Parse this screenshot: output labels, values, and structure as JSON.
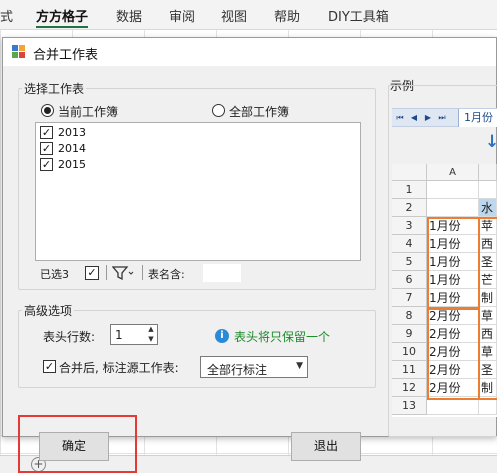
{
  "ribbon": {
    "tabs": [
      {
        "label": "式"
      },
      {
        "label": "方方格子"
      },
      {
        "label": "数据"
      },
      {
        "label": "审阅"
      },
      {
        "label": "视图"
      },
      {
        "label": "帮助"
      },
      {
        "label": "DIY工具箱"
      }
    ]
  },
  "dialog": {
    "title": "合并工作表",
    "select_group": {
      "label": "选择工作表",
      "radio_current": "当前工作簿",
      "radio_all": "全部工作簿",
      "sheets": [
        {
          "name": "2013",
          "checked": true
        },
        {
          "name": "2014",
          "checked": true
        },
        {
          "name": "2015",
          "checked": true
        }
      ],
      "selected_count_label": "已选3",
      "sheet_name_label": "表名含:",
      "sheet_name_value": ""
    },
    "advanced_group": {
      "label": "高级选项",
      "header_rows_label": "表头行数:",
      "header_rows_value": "1",
      "hint": "表头将只保留一个",
      "mark_source_label": "合并后, 标注源工作表:",
      "mark_source_value": "全部行标注"
    },
    "ok_button": "确定",
    "exit_button": "退出",
    "example": {
      "label": "示例",
      "sheet_tab": "1月份",
      "column_a": "A",
      "rows": [
        {
          "num": "1",
          "a": "",
          "b": ""
        },
        {
          "num": "2",
          "a": "",
          "b": "水"
        },
        {
          "num": "3",
          "a": "1月份",
          "b": "苹"
        },
        {
          "num": "4",
          "a": "1月份",
          "b": "西"
        },
        {
          "num": "5",
          "a": "1月份",
          "b": "圣"
        },
        {
          "num": "6",
          "a": "1月份",
          "b": "芒"
        },
        {
          "num": "7",
          "a": "1月份",
          "b": "制"
        },
        {
          "num": "8",
          "a": "2月份",
          "b": "草"
        },
        {
          "num": "9",
          "a": "2月份",
          "b": "西"
        },
        {
          "num": "10",
          "a": "2月份",
          "b": "草"
        },
        {
          "num": "11",
          "a": "2月份",
          "b": "圣"
        },
        {
          "num": "12",
          "a": "2月份",
          "b": "制"
        },
        {
          "num": "13",
          "a": "",
          "b": ""
        }
      ]
    }
  },
  "colors": {
    "excel_green": "#217346",
    "highlight_red": "#e53935",
    "example_orange": "#ed7d31",
    "hint_green": "#1a8a2a",
    "header_blue": "#bdd7ee"
  },
  "icons": [
    "merge-sheets-icon",
    "check-all-icon",
    "filter-icon",
    "info-icon",
    "dropdown-arrow-icon",
    "down-arrow-icon",
    "add-sheet-icon"
  ]
}
